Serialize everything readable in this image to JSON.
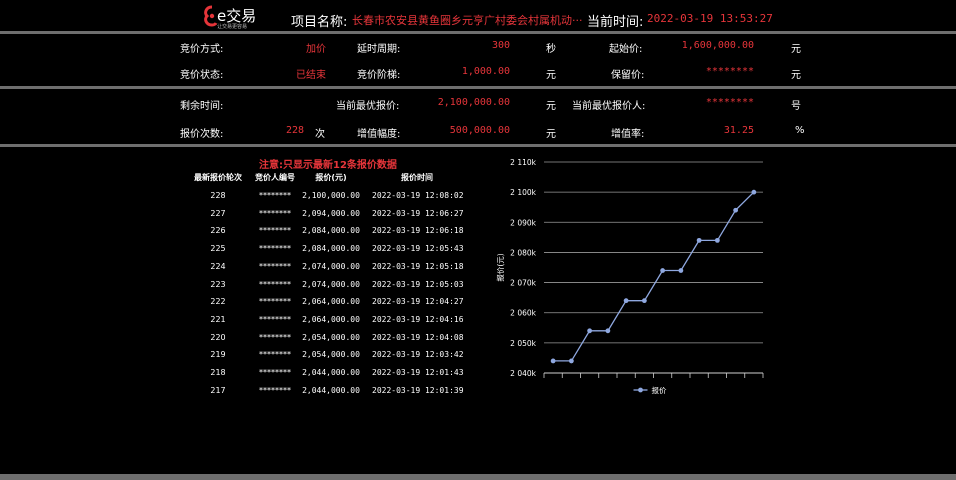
{
  "header": {
    "logo": {
      "brand": "e交易",
      "slogan": "让交易更容易"
    },
    "project_label": "项目名称:",
    "project_name": "长春市农安县黄鱼圈乡元亨广村委会村属机动···",
    "time_label": "当前时间:",
    "current_time": "2022-03-19 13:53:27"
  },
  "info1": {
    "row1": {
      "bid_method_label": "竞价方式:",
      "bid_method": "加价",
      "delay_label": "延时周期:",
      "delay": "300",
      "delay_unit": "秒",
      "start_price_label": "起始价:",
      "start_price": "1,600,000.00",
      "start_price_unit": "元"
    },
    "row2": {
      "status_label": "竞价状态:",
      "status": "已结束",
      "step_label": "竞价阶梯:",
      "step": "1,000.00",
      "step_unit": "元",
      "reserve_label": "保留价:",
      "reserve": "********",
      "reserve_unit": "元"
    }
  },
  "info2": {
    "row1": {
      "remaining_label": "剩余时间:",
      "best_price_label": "当前最优报价:",
      "best_price": "2,100,000.00",
      "best_price_unit": "元",
      "best_bidder_label": "当前最优报价人:",
      "best_bidder": "********",
      "best_bidder_unit": "号"
    },
    "row2": {
      "count_label": "报价次数:",
      "count": "228",
      "count_unit": "次",
      "increase_label": "增值幅度:",
      "increase": "500,000.00",
      "increase_unit": "元",
      "rate_label": "增值率:",
      "rate": "31.25",
      "rate_unit": "%"
    }
  },
  "notice": "注意:只显示最新12条报价数据",
  "table": {
    "headers": [
      "最新报价轮次",
      "竞价人编号",
      "报价(元)",
      "报价时间"
    ],
    "rows": [
      [
        "228",
        "********",
        "2,100,000.00",
        "2022-03-19 12:08:02"
      ],
      [
        "227",
        "********",
        "2,094,000.00",
        "2022-03-19 12:06:27"
      ],
      [
        "226",
        "********",
        "2,084,000.00",
        "2022-03-19 12:06:18"
      ],
      [
        "225",
        "********",
        "2,084,000.00",
        "2022-03-19 12:05:43"
      ],
      [
        "224",
        "********",
        "2,074,000.00",
        "2022-03-19 12:05:18"
      ],
      [
        "223",
        "********",
        "2,074,000.00",
        "2022-03-19 12:05:03"
      ],
      [
        "222",
        "********",
        "2,064,000.00",
        "2022-03-19 12:04:27"
      ],
      [
        "221",
        "********",
        "2,064,000.00",
        "2022-03-19 12:04:16"
      ],
      [
        "220",
        "********",
        "2,054,000.00",
        "2022-03-19 12:04:08"
      ],
      [
        "219",
        "********",
        "2,054,000.00",
        "2022-03-19 12:03:42"
      ],
      [
        "218",
        "********",
        "2,044,000.00",
        "2022-03-19 12:01:43"
      ],
      [
        "217",
        "********",
        "2,044,000.00",
        "2022-03-19 12:01:39"
      ]
    ]
  },
  "colors": {
    "accent": "#e6353a",
    "line": "#8fa8e0",
    "background": "#000000",
    "separator": "#6e6e6e"
  },
  "chart_data": {
    "type": "line",
    "ylabel": "报价(元)",
    "ylim": [
      2040000,
      2110000
    ],
    "yticks": [
      2040000,
      2050000,
      2060000,
      2070000,
      2080000,
      2090000,
      2100000,
      2110000
    ],
    "ytick_labels": [
      "2 040k",
      "2 050k",
      "2 060k",
      "2 070k",
      "2 080k",
      "2 090k",
      "2 100k",
      "2 110k"
    ],
    "grid": true,
    "legend": "bottom",
    "series": [
      {
        "name": "报价",
        "values": [
          2044000,
          2044000,
          2054000,
          2054000,
          2064000,
          2064000,
          2074000,
          2074000,
          2084000,
          2084000,
          2094000,
          2100000
        ]
      }
    ]
  }
}
